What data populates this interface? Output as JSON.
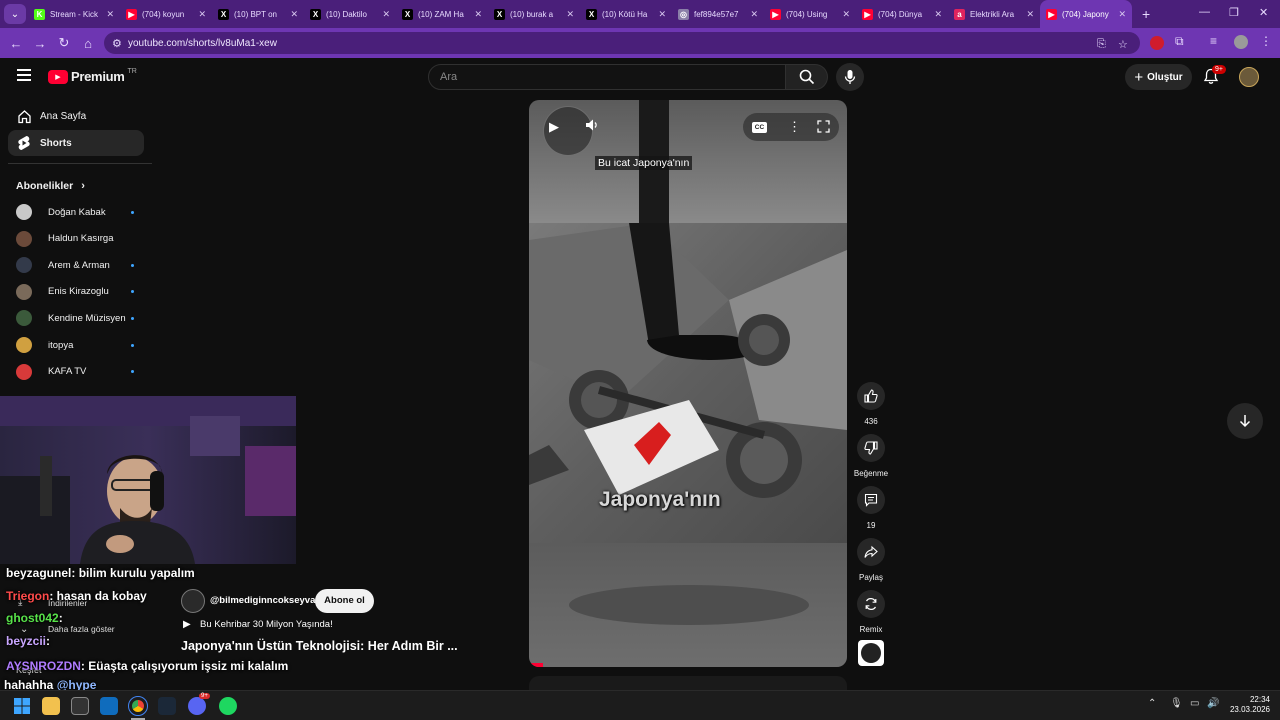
{
  "browser": {
    "tabs": [
      {
        "title": "Stream - Kick",
        "fav_color": "#53fc18",
        "fav_text": "K"
      },
      {
        "title": "(704) koyun",
        "fav_color": "#ff0033",
        "fav_text": "▶"
      },
      {
        "title": "(10) BPT on",
        "fav_color": "#000000",
        "fav_text": "X"
      },
      {
        "title": "(10) Daktilo",
        "fav_color": "#000000",
        "fav_text": "X"
      },
      {
        "title": "(10) ZAM Ha",
        "fav_color": "#000000",
        "fav_text": "X"
      },
      {
        "title": "(10) burak a",
        "fav_color": "#000000",
        "fav_text": "X"
      },
      {
        "title": "(10) Kötü Ha",
        "fav_color": "#000000",
        "fav_text": "X"
      },
      {
        "title": "fef894e57e7",
        "fav_color": "#8a7fa8",
        "fav_text": "◎"
      },
      {
        "title": "(704) Using",
        "fav_color": "#ff0033",
        "fav_text": "▶"
      },
      {
        "title": "(704) Dünya",
        "fav_color": "#ff0033",
        "fav_text": "▶"
      },
      {
        "title": "Elektrikli Ara",
        "fav_color": "#e0245e",
        "fav_text": "a"
      },
      {
        "title": "(704) Japony",
        "fav_color": "#ff0033",
        "fav_text": "▶"
      }
    ],
    "url": "youtube.com/shorts/lv8uMa1-xew"
  },
  "yt": {
    "logo_text": "Premium",
    "logo_region": "TR",
    "search_placeholder": "Ara",
    "create_label": "Oluştur",
    "notif_badge": "9+"
  },
  "sidebar": {
    "home": "Ana Sayfa",
    "shorts": "Shorts",
    "subs_title": "Abonelikler",
    "subs": [
      {
        "name": "Doğan Kabak",
        "color": "#c9c9c9",
        "dot": true
      },
      {
        "name": "Haldun Kasırga",
        "color": "#6b4a3a",
        "dot": false
      },
      {
        "name": "Arem & Arman",
        "color": "#333a4a",
        "dot": true
      },
      {
        "name": "Enis Kirazoglu",
        "color": "#7a6a5a",
        "dot": true
      },
      {
        "name": "Kendine Müzisyen",
        "color": "#3b5a3b",
        "dot": true
      },
      {
        "name": "itopya",
        "color": "#d0a040",
        "dot": true
      },
      {
        "name": "KAFA TV",
        "color": "#d83a3a",
        "dot": true
      }
    ],
    "hidden_items": [
      "İndirilenler",
      "Daha fazla göster",
      "Keşfet"
    ]
  },
  "short": {
    "caption": "Bu icat Japonya'nın",
    "video_text": "Japonya'nın",
    "channel": "@bilmediginncokseyvar",
    "subscribe": "Abone ol",
    "music": "Bu Kehribar 30 Milyon Yaşında!",
    "title": "Japonya'nın Üstün Teknolojisi: Her Adım Bir ...",
    "likes": "436",
    "dislike": "Beğenme",
    "comments": "19",
    "share": "Paylaş",
    "remix": "Remix"
  },
  "chat": [
    {
      "user": "beyzagunel",
      "user_color": "#ffffff",
      "msg": ": bilim kurulu yapalım"
    },
    {
      "user": "Triegon",
      "user_color": "#ff4b4b",
      "msg": ": hasan da kobay"
    },
    {
      "user": "ghost042",
      "user_color": "#58e34a",
      "msg": ":"
    },
    {
      "user": "beyzcii",
      "user_color": "#c9a6ff",
      "msg": ":"
    },
    {
      "user": "AYSNROZDN",
      "user_color": "#b07cff",
      "msg": ": Eüaşta çalışıyorum işsiz mi kalalım"
    },
    {
      "user": "",
      "user_color": "#ffffff",
      "msg": "hahahha",
      "mention": "@hype"
    }
  ],
  "taskbar": {
    "time": "22:34",
    "date": "23.03.2026",
    "discord_badge": "9+"
  }
}
